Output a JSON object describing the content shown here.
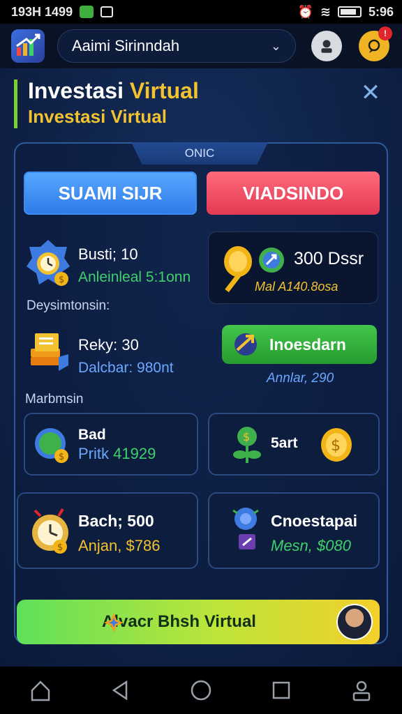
{
  "status": {
    "left_text": "193H 1499",
    "right_time": "5:96"
  },
  "appbar": {
    "account": "Aaimi Sirinndah"
  },
  "page": {
    "title_main_white": "Investasi",
    "title_main_yellow": "Virtual",
    "subtitle": "Investasi Virtual"
  },
  "card": {
    "tab_label": "ONIC",
    "buy_label": "SUAMI SIJR",
    "sell_label": "VIADSINDO",
    "stat1": {
      "line1": "Busti; 10",
      "line2": "Anleinleal 5:1onn"
    },
    "promo": {
      "line1": "300 Dssr",
      "line2": "Mal A140.8osa"
    },
    "section1": "Deysimtonsin:",
    "stat2": {
      "line1": "Reky: 30",
      "line2": "Dalcbar: 980nt"
    },
    "invest_button": "Inoesdarn",
    "invest_sub": "Annlar, 290",
    "section2": "Marbmsin",
    "tile1": {
      "line1": "Bad",
      "line2a": "Pritk ",
      "line2b": "41929"
    },
    "tile2": {
      "line1": "5art"
    },
    "tile3": {
      "line1": "Bach; 500",
      "line2": "Anjan, $786"
    },
    "tile4": {
      "line1": "Cnoestapai",
      "line2": "Mesn, $080"
    },
    "cta_label": "Alvacr Bhsh Virtual"
  },
  "colors": {
    "accent_green": "#3fd06b",
    "accent_yellow": "#f2c230",
    "buy_blue": "#2f79e8",
    "sell_red": "#e33a53"
  }
}
